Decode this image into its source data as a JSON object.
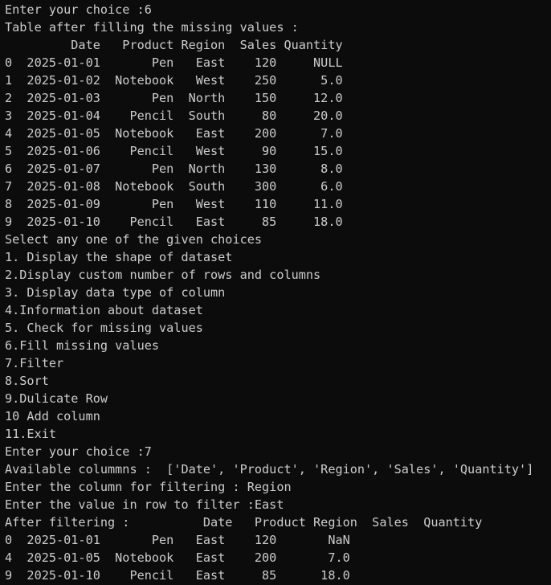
{
  "lines": [
    "Enter your choice :6",
    "Table after filling the missing values :",
    "         Date   Product Region  Sales Quantity",
    "0  2025-01-01       Pen   East    120     NULL",
    "1  2025-01-02  Notebook   West    250      5.0",
    "2  2025-01-03       Pen  North    150     12.0",
    "3  2025-01-04    Pencil  South     80     20.0",
    "4  2025-01-05  Notebook   East    200      7.0",
    "5  2025-01-06    Pencil   West     90     15.0",
    "6  2025-01-07       Pen  North    130      8.0",
    "7  2025-01-08  Notebook  South    300      6.0",
    "8  2025-01-09       Pen   West    110     11.0",
    "9  2025-01-10    Pencil   East     85     18.0",
    "Select any one of the given choices",
    "1. Display the shape of dataset",
    "2.Display custom number of rows and columns",
    "3. Display data type of column",
    "4.Information about dataset",
    "5. Check for missing values",
    "6.Fill missing values",
    "7.Filter",
    "8.Sort",
    "9.Dulicate Row",
    "10 Add column",
    "11.Exit",
    "Enter your choice :7",
    "Available colummns :  ['Date', 'Product', 'Region', 'Sales', 'Quantity']",
    "Enter the column for filtering : Region",
    "Enter the value in row to filter :East",
    "After filtering :          Date   Product Region  Sales  Quantity",
    "0  2025-01-01       Pen   East    120       NaN",
    "4  2025-01-05  Notebook   East    200       7.0",
    "9  2025-01-10    Pencil   East     85      18.0"
  ]
}
